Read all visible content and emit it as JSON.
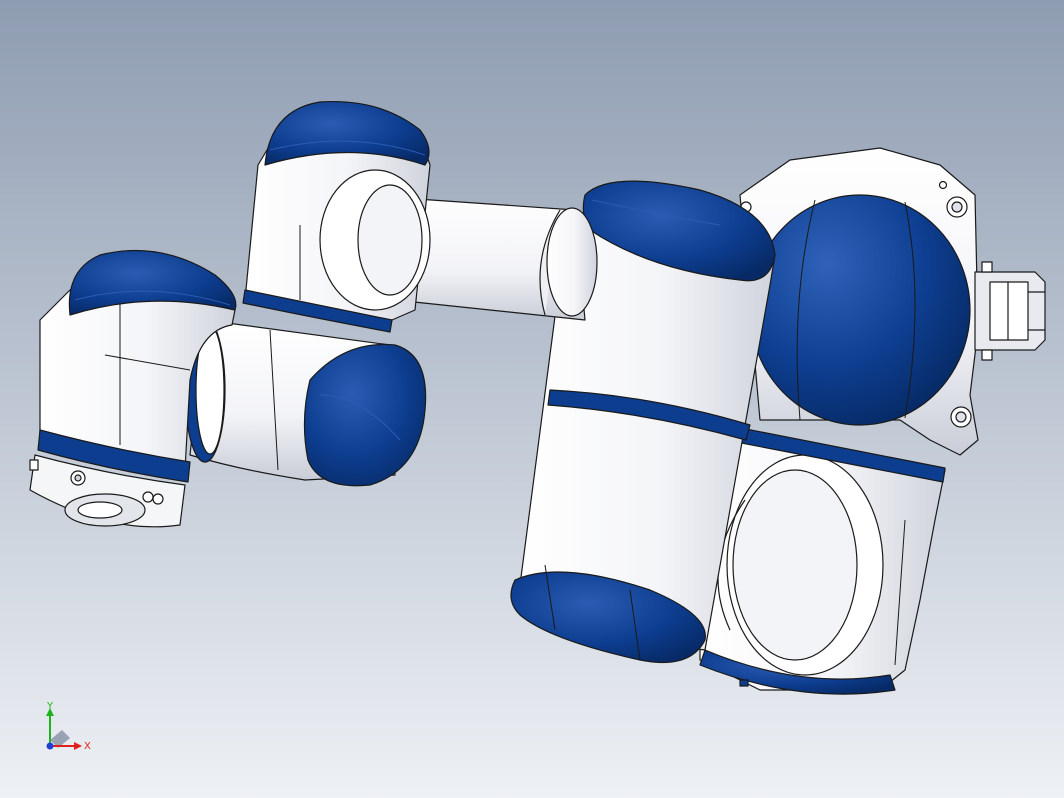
{
  "viewport": {
    "background_top": "#8e9cb1",
    "background_bottom": "#eef1f5"
  },
  "model": {
    "body_color": "#ffffff",
    "body_shade": "#cfd3dc",
    "cap_color": "#0d3d8f",
    "cap_dark": "#072a66",
    "edge_color": "#1a1a1a"
  },
  "triad": {
    "x_label": "X",
    "y_label": "Y",
    "x_color": "#e0201b",
    "y_color": "#1eb31e",
    "z_color": "#1c3fd6"
  }
}
